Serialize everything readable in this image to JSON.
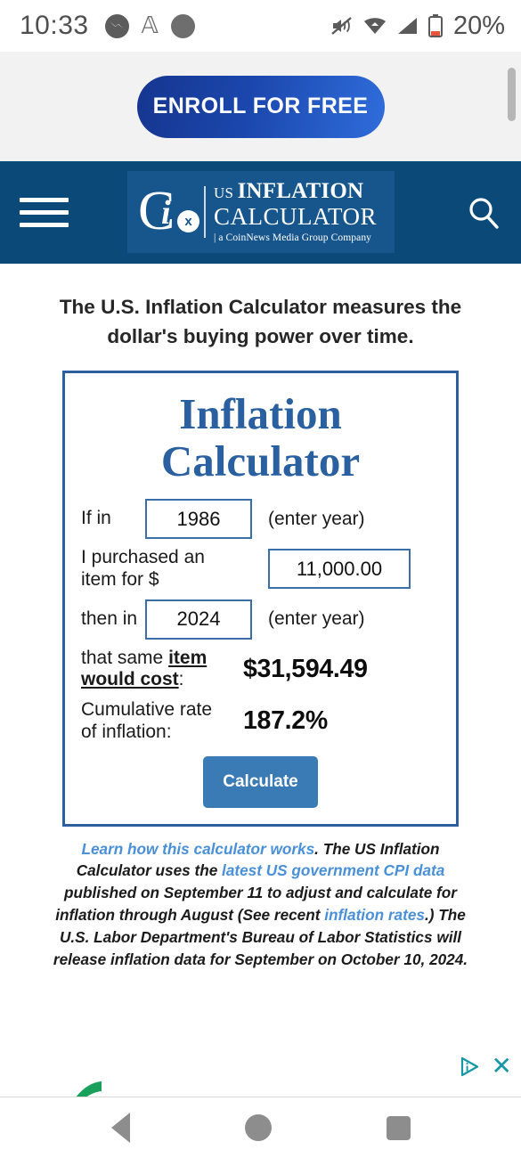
{
  "statusbar": {
    "time": "10:33",
    "battery_percent": "20%",
    "icons": [
      "messenger-icon",
      "font-a-icon",
      "gray-dot-icon",
      "mute-icon",
      "wifi-icon",
      "cellular-signal-icon",
      "battery-icon"
    ]
  },
  "promo": {
    "cta_label": "ENROLL FOR FREE"
  },
  "header": {
    "menu_label": "Menu",
    "logo": {
      "mark_letter": "C",
      "mark_i": "i",
      "mark_badge": "x",
      "line1_small": "US ",
      "line1_big": "INFLATION",
      "line2": "CALCULATOR",
      "line3": "| a CoinNews Media Group Company"
    },
    "search_label": "Search"
  },
  "main": {
    "tagline": "The U.S. Inflation Calculator measures the dollar's buying power over time.",
    "calculator": {
      "title_line1": "Inflation",
      "title_line2": "Calculator",
      "rows": {
        "start_label": "If in",
        "start_year": "1986",
        "start_hint": "(enter year)",
        "amount_label": "I purchased an item for $",
        "amount_value": "11,000.00",
        "end_label": "then in",
        "end_year": "2024",
        "end_hint": "(enter year)",
        "cost_label_pre": "that same ",
        "cost_label_underline": "item would cost",
        "cost_label_post": ":",
        "cost_value": "$31,594.49",
        "rate_label": "Cumulative rate of inflation:",
        "rate_value": "187.2%"
      },
      "calculate_label": "Calculate"
    },
    "footnote": {
      "link1": "Learn how this calculator works",
      "text1": ". The US Inflation Calculator uses the ",
      "link2": "latest US government CPI data",
      "text2": " published on September 11 to adjust and calculate for inflation through August (See recent ",
      "link3": "inflation rates",
      "text3": ".) The U.S. Labor Department's Bureau of Labor Statistics will release inflation data for September on October 10, 2024."
    }
  },
  "bottom_ad": {
    "adchoices_label": "AdChoices",
    "close_label": "✕"
  },
  "navbar": {
    "back_label": "Back",
    "home_label": "Home",
    "recents_label": "Recents"
  },
  "colors": {
    "header_blue": "#0b4a78",
    "logo_box_blue": "#17568c",
    "calc_border_blue": "#2d5f9e",
    "calc_title_blue": "#2a5fa0",
    "button_blue": "#3a7ab5",
    "link_blue": "#4a90d9",
    "ad_teal": "#1796a6",
    "promo_bg": "#f2f2f2"
  }
}
